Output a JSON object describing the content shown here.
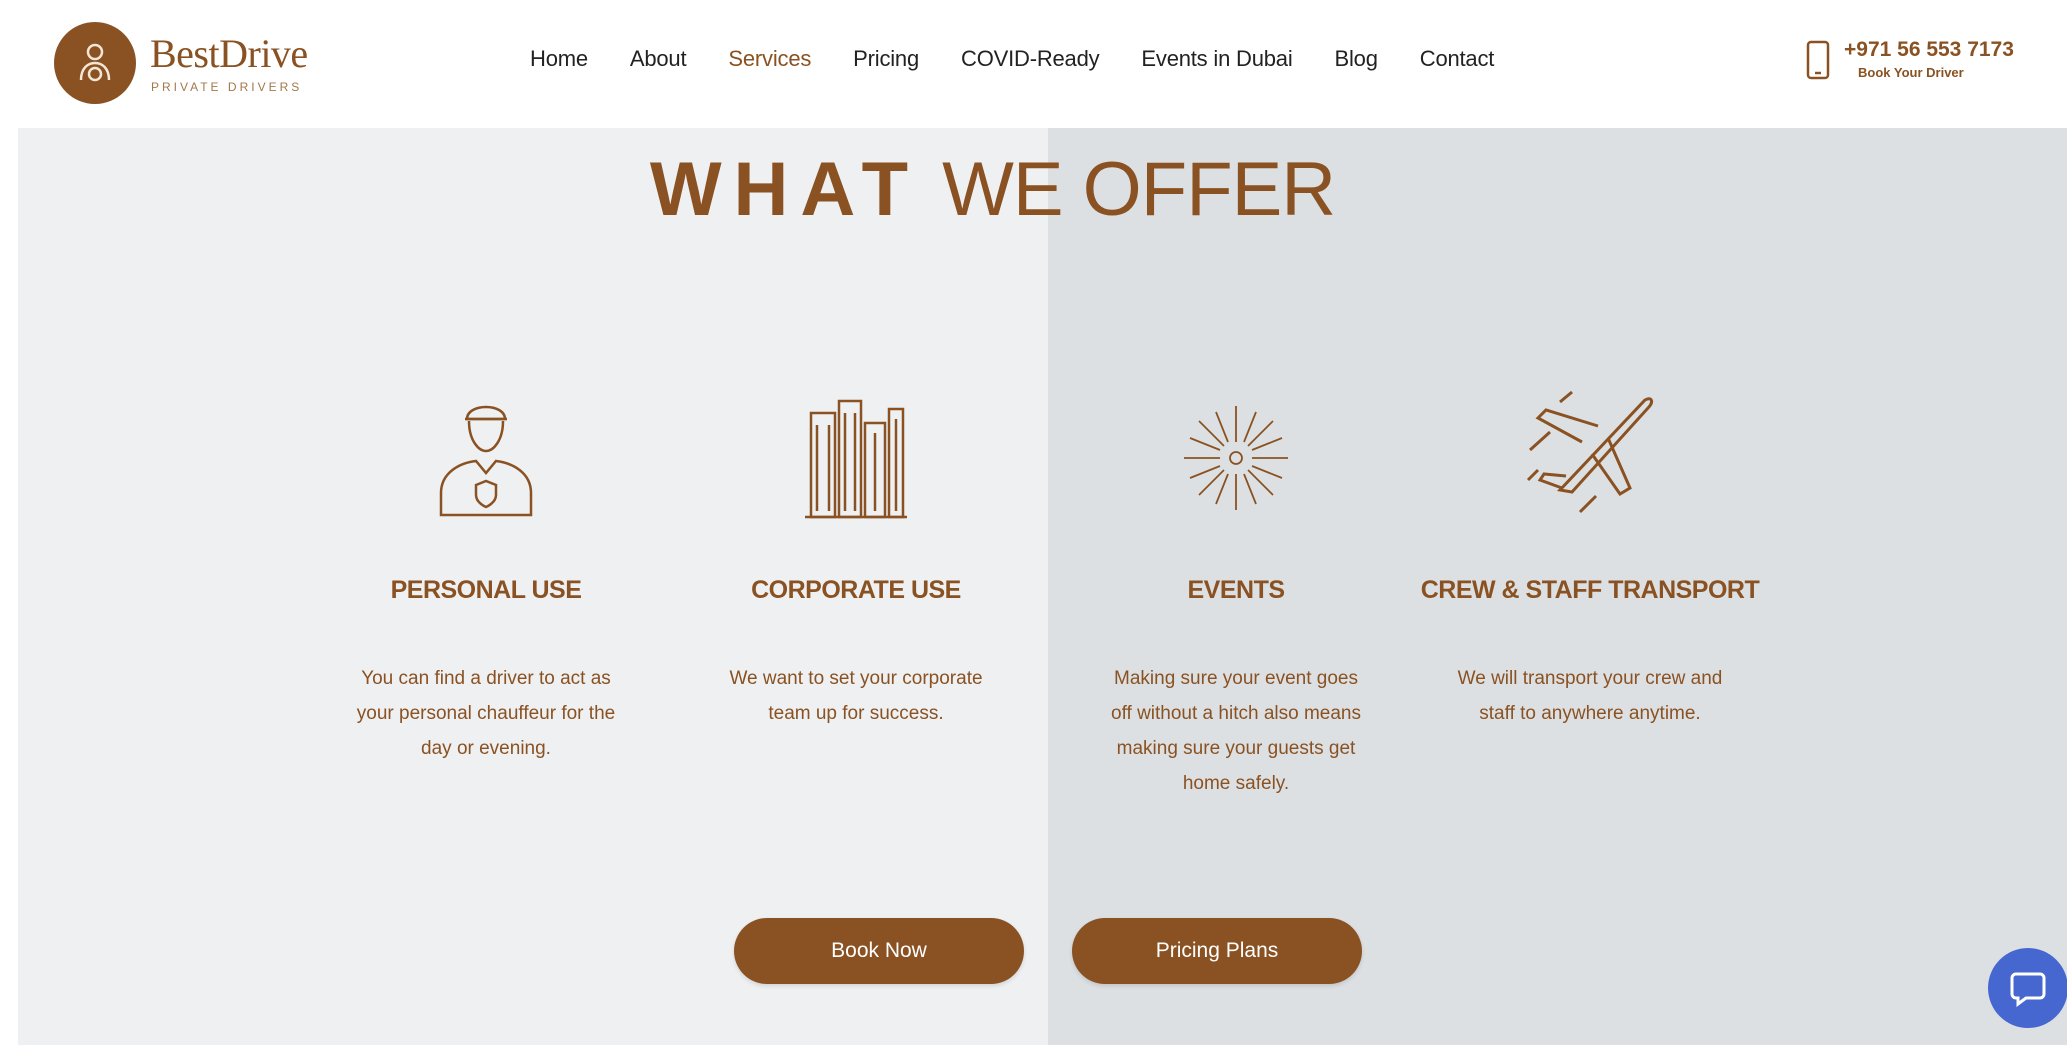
{
  "header": {
    "logo": {
      "name": "BestDrive",
      "tagline": "PRIVATE DRIVERS"
    },
    "nav": [
      {
        "label": "Home",
        "active": false
      },
      {
        "label": "About",
        "active": false
      },
      {
        "label": "Services",
        "active": true
      },
      {
        "label": "Pricing",
        "active": false
      },
      {
        "label": "COVID-Ready",
        "active": false
      },
      {
        "label": "Events in Dubai",
        "active": false
      },
      {
        "label": "Blog",
        "active": false
      },
      {
        "label": "Contact",
        "active": false
      }
    ],
    "phone": {
      "number": "+971 56 553 7173",
      "sub_label": "Book Your Driver"
    }
  },
  "section": {
    "heading_bold": "WHAT",
    "heading_light": "WE OFFER",
    "cards": [
      {
        "icon": "chauffeur-icon",
        "title": "PERSONAL USE",
        "description": "You can find a driver to act as your personal chauffeur for the day or evening."
      },
      {
        "icon": "buildings-icon",
        "title": "CORPORATE USE",
        "description": "We want to set your corporate team up for success."
      },
      {
        "icon": "fireworks-icon",
        "title": "EVENTS",
        "description": "Making sure your event goes off without a hitch also means making sure your guests get home safely."
      },
      {
        "icon": "airplane-icon",
        "title": "CREW & STAFF TRANSPORT",
        "description": "We will transport your crew and staff to anywhere anytime."
      }
    ],
    "buttons": {
      "book_now": "Book Now",
      "pricing_plans": "Pricing Plans"
    }
  },
  "colors": {
    "brand": "#8a5222",
    "background_left": "#eef0f2",
    "background_right": "#dde0e3",
    "chat": "#4767d0"
  },
  "chat": {
    "icon": "chat-icon"
  }
}
